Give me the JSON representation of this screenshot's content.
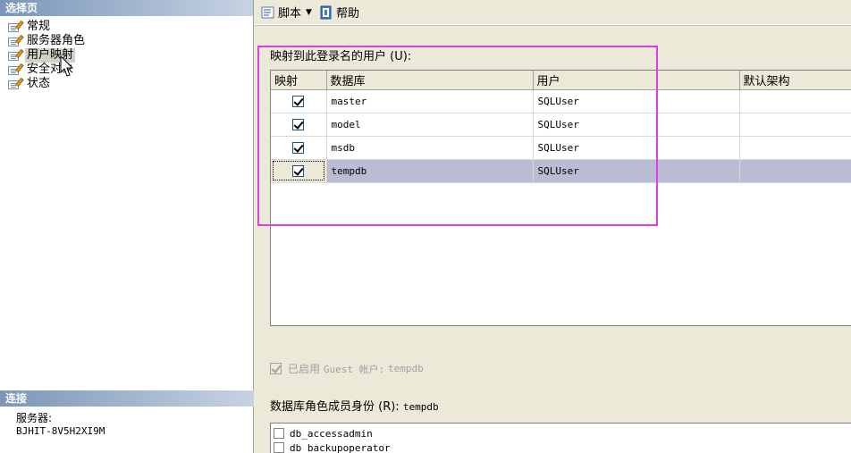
{
  "left_pane": {
    "header": "选择页",
    "pages": [
      {
        "label": "常规",
        "selected": false
      },
      {
        "label": "服务器角色",
        "selected": false
      },
      {
        "label": "用户映射",
        "selected": true
      },
      {
        "label": "安全对象",
        "selected": false
      },
      {
        "label": "状态",
        "selected": false
      }
    ],
    "connection": {
      "header": "连接",
      "server_label": "服务器:",
      "server_value": "BJHIT-8V5H2XI9M"
    }
  },
  "toolbar": {
    "script_label": "脚本",
    "help_label": "帮助"
  },
  "mapping": {
    "label": "映射到此登录名的用户 (U):",
    "columns": [
      "映射",
      "数据库",
      "用户",
      "默认架构"
    ],
    "rows": [
      {
        "mapped": true,
        "database": "master",
        "user": "SQLUser",
        "schema": "",
        "selected": false
      },
      {
        "mapped": true,
        "database": "model",
        "user": "SQLUser",
        "schema": "",
        "selected": false
      },
      {
        "mapped": true,
        "database": "msdb",
        "user": "SQLUser",
        "schema": "",
        "selected": false
      },
      {
        "mapped": true,
        "database": "tempdb",
        "user": "SQLUser",
        "schema": "",
        "selected": true
      }
    ]
  },
  "guest": {
    "checked": true,
    "label": "已启用",
    "account": "Guest 帐户:",
    "db": "tempdb"
  },
  "roles": {
    "label": "数据库角色成员身份 (R):",
    "db": "tempdb",
    "items": [
      {
        "name": "db_accessadmin",
        "checked": false
      },
      {
        "name": "db_backupoperator",
        "checked": false
      }
    ]
  },
  "colors": {
    "highlight": "#e040e0",
    "selected_row": "#b8bdd4"
  }
}
